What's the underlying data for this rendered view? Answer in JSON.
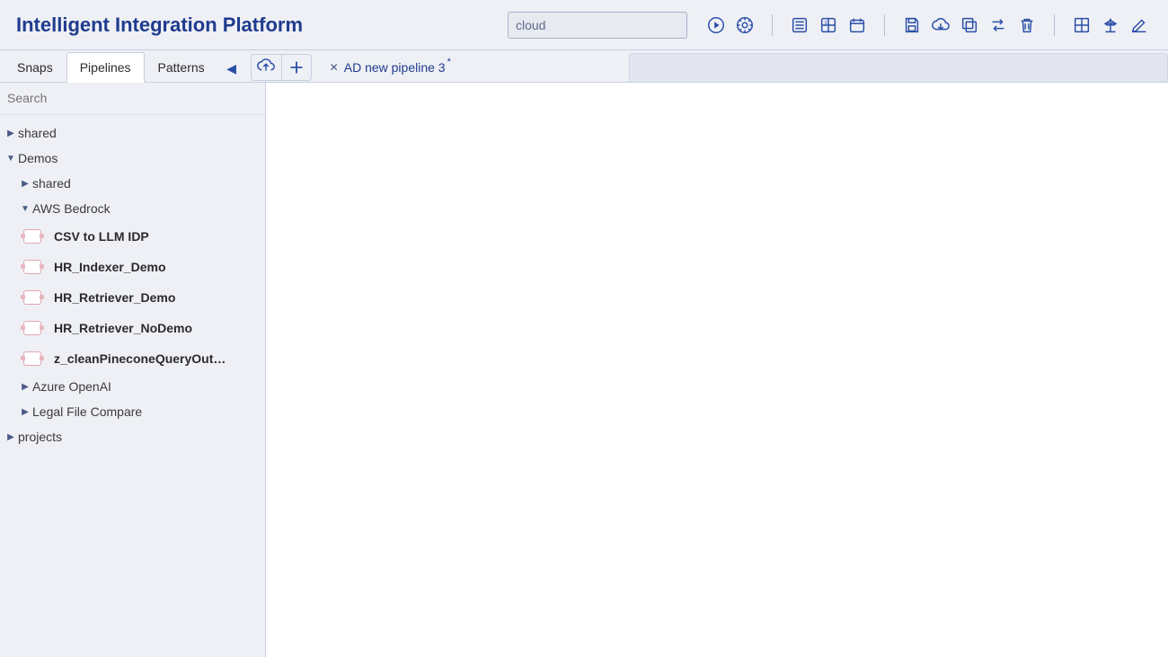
{
  "header": {
    "title": "Intelligent Integration Platform",
    "search_value": "cloud"
  },
  "toolbar": {
    "icons": [
      "play-circle-icon",
      "gear-circle-icon",
      "list-icon",
      "grid-icon",
      "calendar-icon",
      "save-icon",
      "cloud-download-icon",
      "copy-icon",
      "swap-icon",
      "trash-icon",
      "layout-icon",
      "scale-icon",
      "edit-icon"
    ]
  },
  "tabs": {
    "left": [
      "Snaps",
      "Pipelines",
      "Patterns"
    ],
    "active_index": 1,
    "open_pipeline": "AD new pipeline 3"
  },
  "sidebar": {
    "search_placeholder": "Search",
    "tree": {
      "shared": "shared",
      "demos": "Demos",
      "demos_children": {
        "shared": "shared",
        "aws": "AWS Bedrock",
        "aws_children": [
          "CSV to LLM IDP",
          "HR_Indexer_Demo",
          "HR_Retriever_Demo",
          "HR_Retriever_NoDemo",
          "z_cleanPineconeQueryOut…"
        ],
        "azure": "Azure OpenAI",
        "legal": "Legal File Compare"
      },
      "projects": "projects"
    }
  }
}
